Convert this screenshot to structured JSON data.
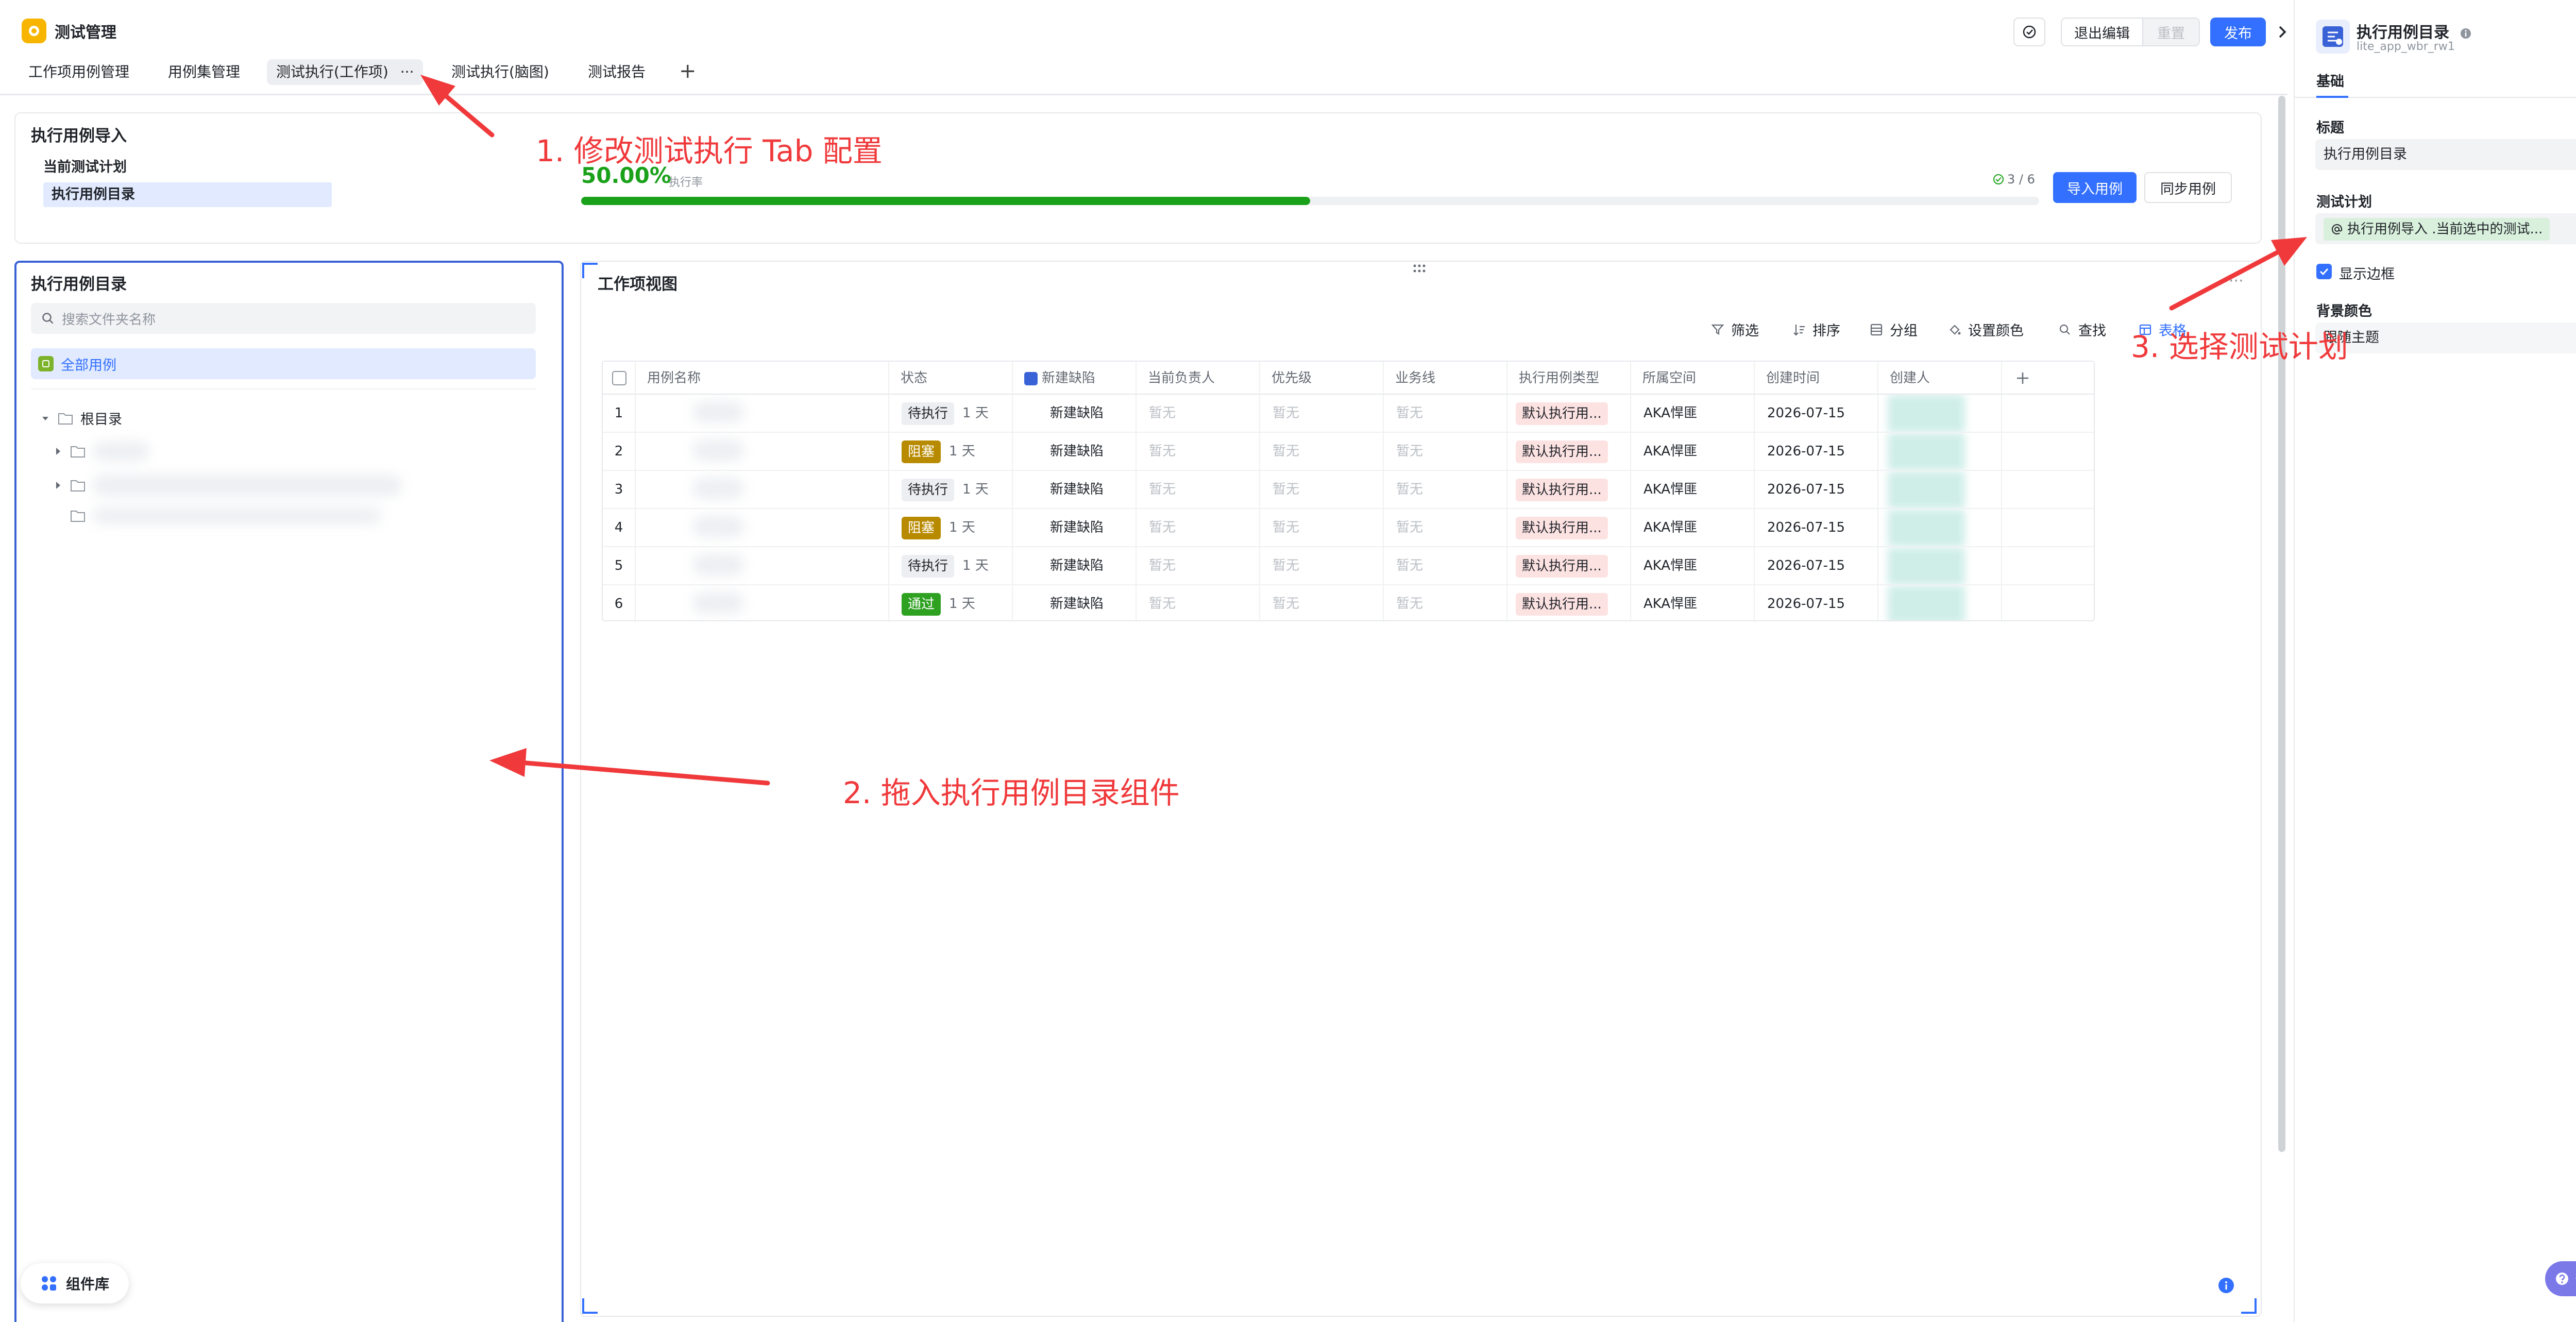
{
  "header": {
    "app_title": "测试管理",
    "tabs": [
      "工作项用例管理",
      "用例集管理",
      "测试执行(工作项)",
      "测试执行(脑图)",
      "测试报告"
    ],
    "active_tab_more": "···",
    "add_tab": "+",
    "exit_edit_label": "退出编辑",
    "reset_label": "重置",
    "publish_label": "发布"
  },
  "import_card": {
    "title": "执行用例导入",
    "current_plan_label": "当前测试计划",
    "plan_item": "执行用例目录",
    "rate_value": "50.00%",
    "rate_fraction": 0.5,
    "rate_label": "执行率",
    "count": "3 / 6",
    "import_button": "导入用例",
    "sync_button": "同步用例"
  },
  "dir_panel": {
    "title": "执行用例目录",
    "search_placeholder": "搜索文件夹名称",
    "all_cases": "全部用例",
    "root_label": "根目录",
    "component_library": "组件库"
  },
  "work_panel": {
    "title": "工作项视图",
    "more": "···",
    "toolbar": {
      "filter": "筛选",
      "sort": "排序",
      "group": "分组",
      "set_color": "设置颜色",
      "find": "查找",
      "table": "表格"
    },
    "columns": [
      "用例名称",
      "状态",
      "新建缺陷",
      "当前负责人",
      "优先级",
      "业务线",
      "执行用例类型",
      "所属空间",
      "创建时间",
      "创建人"
    ],
    "rows": [
      {
        "index": "1",
        "status": "待执行",
        "status_type": "pending",
        "duration": "1 天",
        "defect": "新建缺陷",
        "owner": "暂无",
        "priority": "暂无",
        "biz": "暂无",
        "type": "默认执行用...",
        "space": "AKA悍匪",
        "created": "2026-07-15"
      },
      {
        "index": "2",
        "status": "阻塞",
        "status_type": "blocked",
        "duration": "1 天",
        "defect": "新建缺陷",
        "owner": "暂无",
        "priority": "暂无",
        "biz": "暂无",
        "type": "默认执行用...",
        "space": "AKA悍匪",
        "created": "2026-07-15"
      },
      {
        "index": "3",
        "status": "待执行",
        "status_type": "pending",
        "duration": "1 天",
        "defect": "新建缺陷",
        "owner": "暂无",
        "priority": "暂无",
        "biz": "暂无",
        "type": "默认执行用...",
        "space": "AKA悍匪",
        "created": "2026-07-15"
      },
      {
        "index": "4",
        "status": "阻塞",
        "status_type": "blocked",
        "duration": "1 天",
        "defect": "新建缺陷",
        "owner": "暂无",
        "priority": "暂无",
        "biz": "暂无",
        "type": "默认执行用...",
        "space": "AKA悍匪",
        "created": "2026-07-15"
      },
      {
        "index": "5",
        "status": "待执行",
        "status_type": "pending",
        "duration": "1 天",
        "defect": "新建缺陷",
        "owner": "暂无",
        "priority": "暂无",
        "biz": "暂无",
        "type": "默认执行用...",
        "space": "AKA悍匪",
        "created": "2026-07-15"
      },
      {
        "index": "6",
        "status": "通过",
        "status_type": "passed",
        "duration": "1 天",
        "defect": "新建缺陷",
        "owner": "暂无",
        "priority": "暂无",
        "biz": "暂无",
        "type": "默认执行用...",
        "space": "AKA悍匪",
        "created": "2026-07-15"
      }
    ]
  },
  "right_panel": {
    "title": "执行用例目录",
    "subtitle": "lite_app_wbr_rw1",
    "tab": "基础",
    "title_label": "标题",
    "title_value": "执行用例目录",
    "plan_label": "测试计划",
    "plan_value": "执行用例导入 .当前选中的测试...",
    "show_border_label": "显示边框",
    "bg_color_label": "背景颜色",
    "bg_color_value": "跟随主题",
    "help": "帮助"
  },
  "annotations": {
    "a1": "1. 修改测试执行 Tab 配置",
    "a2": "2. 拖入执行用例目录组件",
    "a3": "3. 选择测试计划"
  },
  "colors": {
    "primary": "#3370ff",
    "progress": "#1aa11a",
    "annotation": "#f0393b",
    "pending_bg": "#eceef1",
    "blocked_bg": "#b88a00",
    "passed_bg": "#2ea121"
  }
}
